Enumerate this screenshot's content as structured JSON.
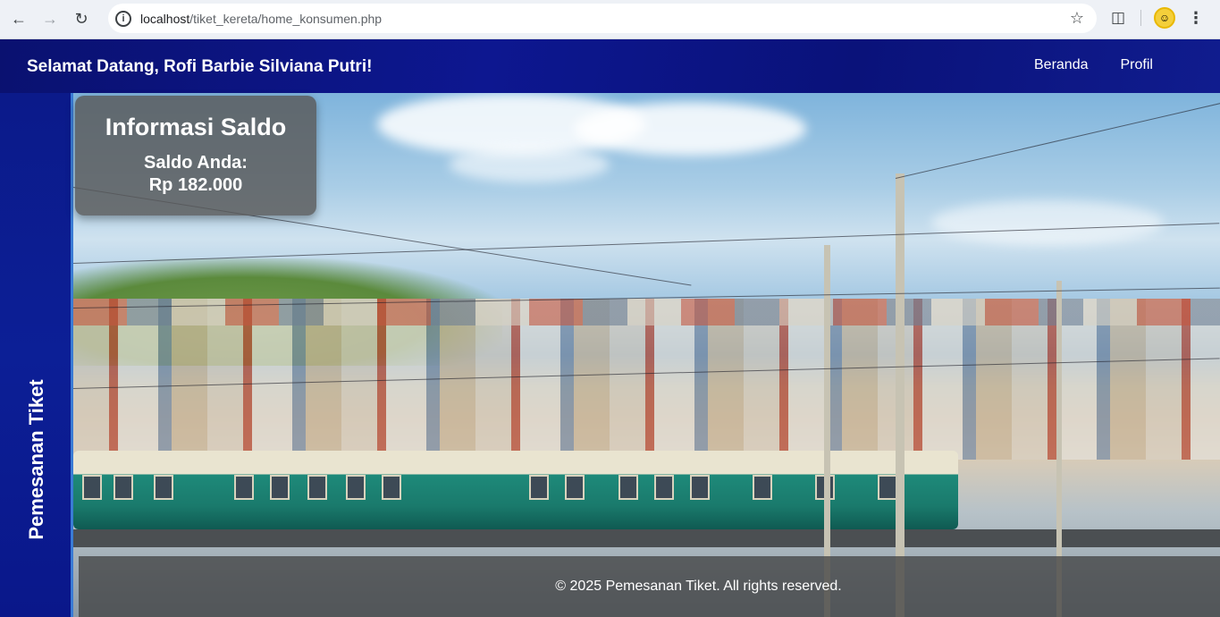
{
  "browser": {
    "url_host": "localhost",
    "url_path": "/tiket_kereta/home_konsumen.php"
  },
  "header": {
    "welcome": "Selamat Datang, Rofi Barbie Silviana Putri!",
    "nav": [
      {
        "label": "Beranda"
      },
      {
        "label": "Profil"
      }
    ]
  },
  "sidebar": {
    "label": "Pemesanan Tiket"
  },
  "saldo": {
    "title": "Informasi Saldo",
    "label": "Saldo Anda:",
    "value": "Rp 182.000"
  },
  "footer": {
    "text": "© 2025 Pemesanan Tiket. All rights reserved."
  },
  "icons": {
    "back": "back-arrow-icon",
    "forward": "forward-arrow-icon",
    "reload": "reload-icon",
    "info": "site-info-icon",
    "bookmark": "bookmark-star-icon",
    "extensions": "extensions-icon",
    "profile": "profile-avatar-icon",
    "menu": "kebab-menu-icon"
  }
}
